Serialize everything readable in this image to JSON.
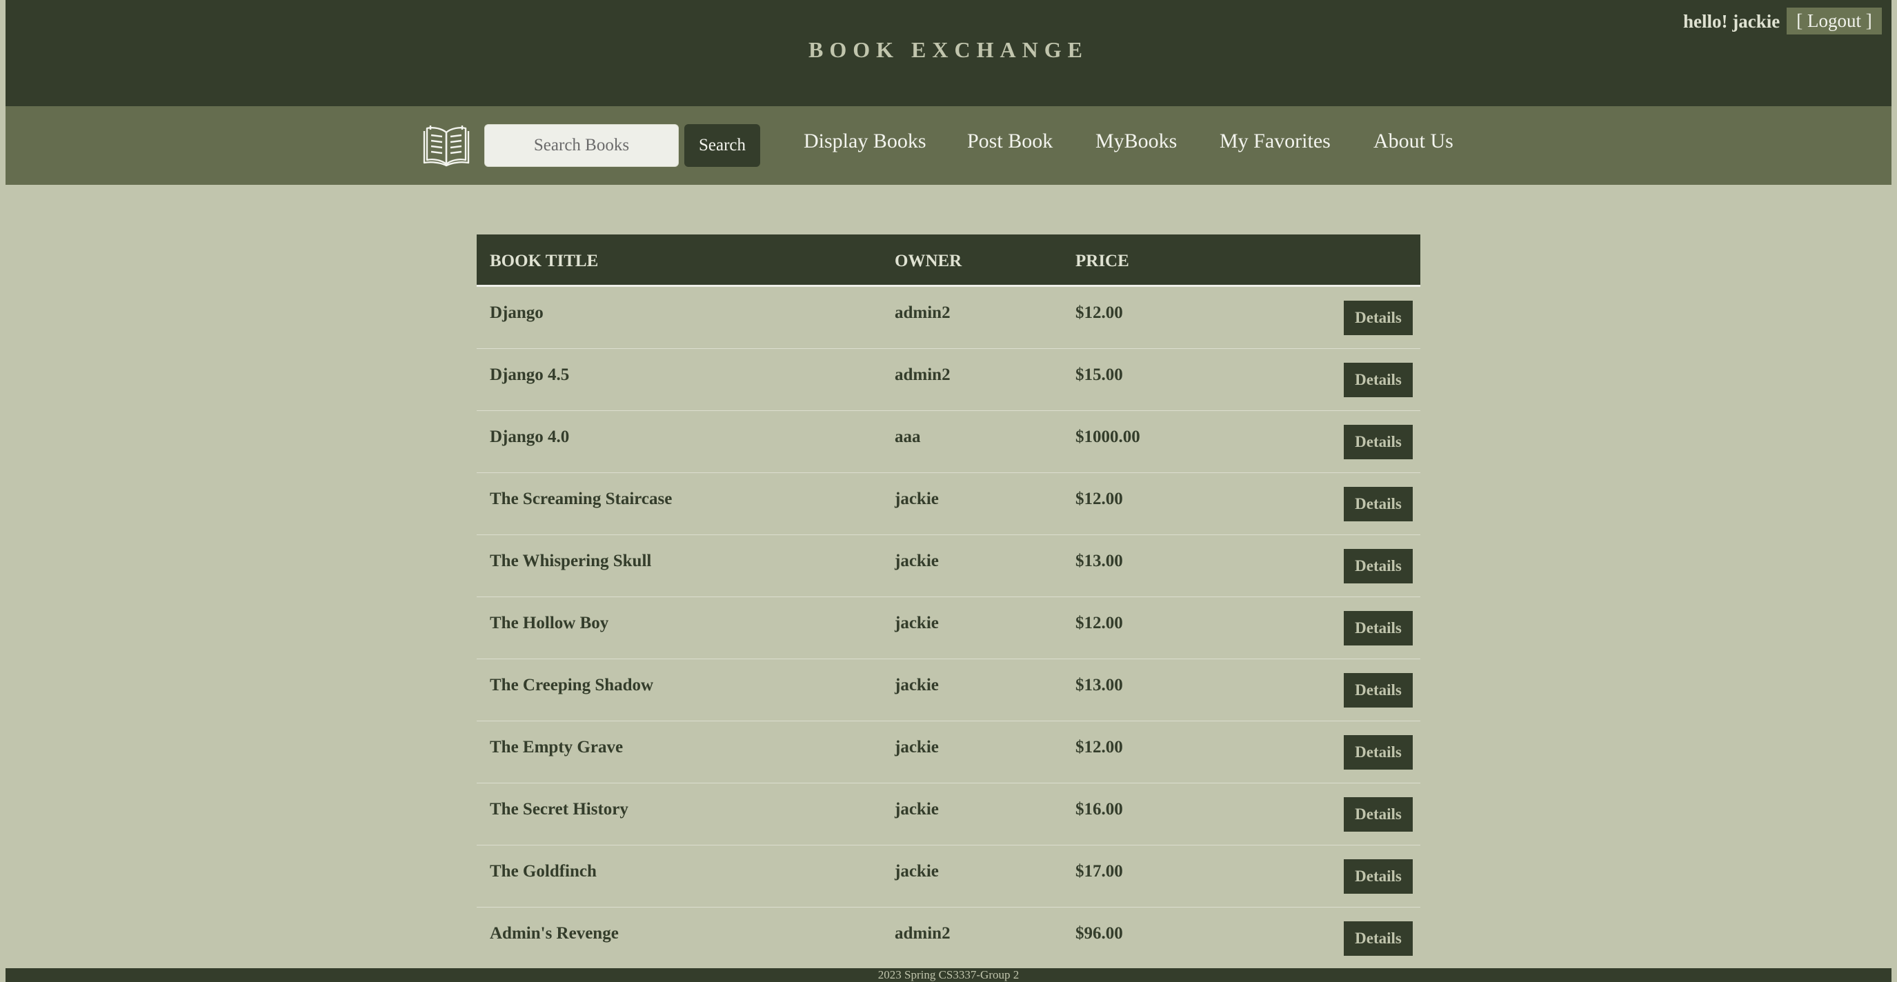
{
  "header": {
    "site_title": "BOOK EXCHANGE",
    "greeting": "hello! jackie",
    "logout_label": "[ Logout ]"
  },
  "nav": {
    "search_placeholder": "Search Books",
    "search_button": "Search",
    "links": [
      "Display Books",
      "Post Book",
      "MyBooks",
      "My Favorites",
      "About Us"
    ]
  },
  "table": {
    "columns": [
      "BOOK TITLE",
      "OWNER",
      "PRICE"
    ],
    "details_label": "Details",
    "rows": [
      {
        "title": "Django",
        "owner": "admin2",
        "price": "$12.00"
      },
      {
        "title": "Django 4.5",
        "owner": "admin2",
        "price": "$15.00"
      },
      {
        "title": "Django 4.0",
        "owner": "aaa",
        "price": "$1000.00"
      },
      {
        "title": "The Screaming Staircase",
        "owner": "jackie",
        "price": "$12.00"
      },
      {
        "title": "The Whispering Skull",
        "owner": "jackie",
        "price": "$13.00"
      },
      {
        "title": "The Hollow Boy",
        "owner": "jackie",
        "price": "$12.00"
      },
      {
        "title": "The Creeping Shadow",
        "owner": "jackie",
        "price": "$13.00"
      },
      {
        "title": "The Empty Grave",
        "owner": "jackie",
        "price": "$12.00"
      },
      {
        "title": "The Secret History",
        "owner": "jackie",
        "price": "$16.00"
      },
      {
        "title": "The Goldfinch",
        "owner": "jackie",
        "price": "$17.00"
      },
      {
        "title": "Admin's Revenge",
        "owner": "admin2",
        "price": "$96.00"
      }
    ]
  },
  "footer": {
    "text": "2023 Spring CS3337-Group 2"
  },
  "colors": {
    "dark_green": "#343d2b",
    "nav_green": "#656d4f",
    "background": "#c1c5ad"
  },
  "icons": {
    "logo": "open-book-icon"
  }
}
